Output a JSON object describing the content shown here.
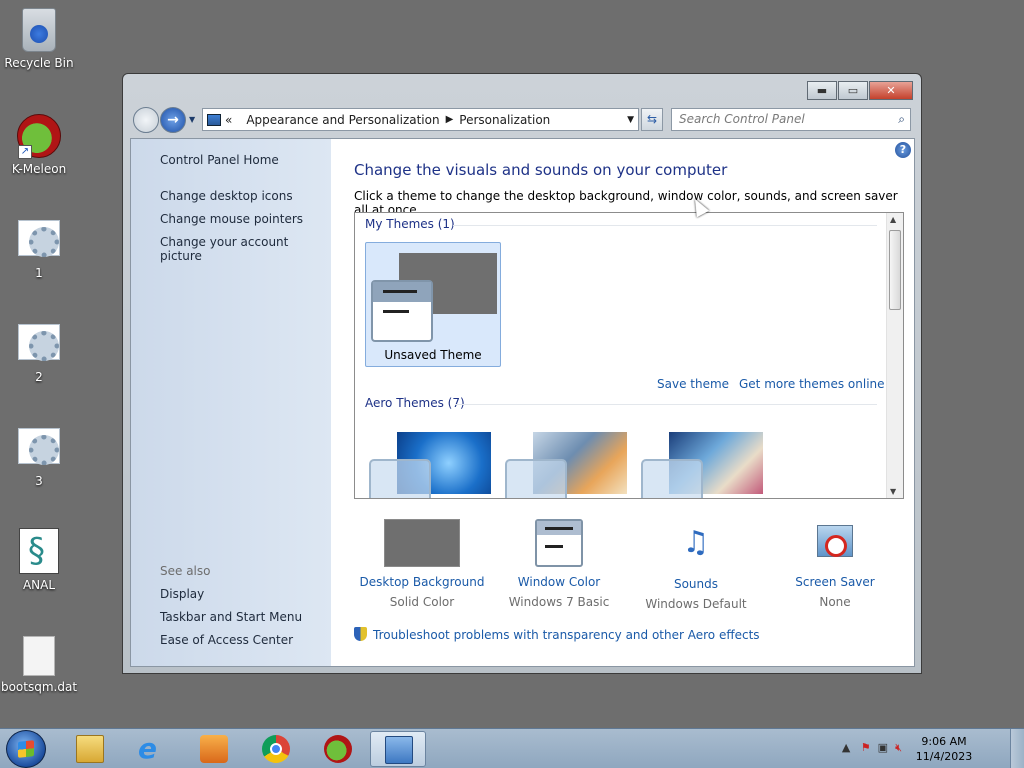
{
  "desktop": {
    "icons": [
      {
        "label": "Recycle Bin"
      },
      {
        "label": "K-Meleon"
      },
      {
        "label": "1"
      },
      {
        "label": "2"
      },
      {
        "label": "3"
      },
      {
        "label": "ANAL"
      },
      {
        "label": "bootsqm.dat"
      }
    ]
  },
  "window": {
    "caption_buttons": {
      "minimize": "▬",
      "maximize": "▭",
      "close": "✕"
    },
    "address": {
      "overflow": "«",
      "crumbs": [
        "Appearance and Personalization",
        "Personalization"
      ],
      "separator": "▶"
    },
    "search": {
      "placeholder": "Search Control Panel"
    },
    "left_pane": {
      "home": "Control Panel Home",
      "links": [
        "Change desktop icons",
        "Change mouse pointers",
        "Change your account picture"
      ],
      "see_also_label": "See also",
      "see_also": [
        "Display",
        "Taskbar and Start Menu",
        "Ease of Access Center"
      ]
    },
    "main": {
      "help": "?",
      "heading": "Change the visuals and sounds on your computer",
      "subheading": "Click a theme to change the desktop background, window color, sounds, and screen saver all at once.",
      "my_themes_label": "My Themes (1)",
      "unsaved_theme": "Unsaved Theme",
      "save_theme": "Save theme",
      "get_more": "Get more themes online",
      "aero_themes_label": "Aero Themes (7)",
      "settings": [
        {
          "title": "Desktop Background",
          "value": "Solid Color"
        },
        {
          "title": "Window Color",
          "value": "Windows 7 Basic"
        },
        {
          "title": "Sounds",
          "value": "Windows Default"
        },
        {
          "title": "Screen Saver",
          "value": "None"
        }
      ],
      "troubleshoot": "Troubleshoot problems with transparency and other Aero effects"
    }
  },
  "taskbar": {
    "pinned": [
      "start-button",
      "explorer-icon",
      "internet-explorer-icon",
      "media-player-icon",
      "chrome-icon",
      "k-meleon-icon",
      "control-panel-icon"
    ],
    "clock": {
      "time": "9:06 AM",
      "date": "11/4/2023"
    }
  },
  "colors": {
    "link": "#1a5aa8",
    "heading": "#1e3287",
    "desktop": "#6e6e6e",
    "selected_theme": "#d9e8fb"
  }
}
